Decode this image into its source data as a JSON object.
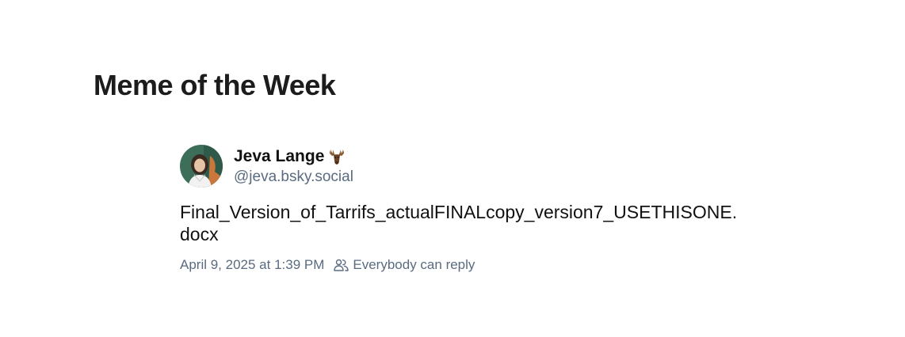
{
  "section": {
    "title": "Meme of the Week"
  },
  "post": {
    "avatar_icon": "user-avatar-photo",
    "author_name": "Jeva Lange",
    "author_emoji_icon": "moose-emoji-icon",
    "author_handle": "@jeva.bsky.social",
    "text_line1": "Final_Version_of_Tarrifs_actualFINALcopy_version7_USETHISONE.",
    "text_line2": "docx",
    "timestamp": "April 9, 2025 at 1:39 PM",
    "reply_icon": "people-icon",
    "reply_setting": "Everybody can reply"
  },
  "colors": {
    "text": "#111111",
    "muted": "#5a6b80",
    "background": "#ffffff"
  }
}
